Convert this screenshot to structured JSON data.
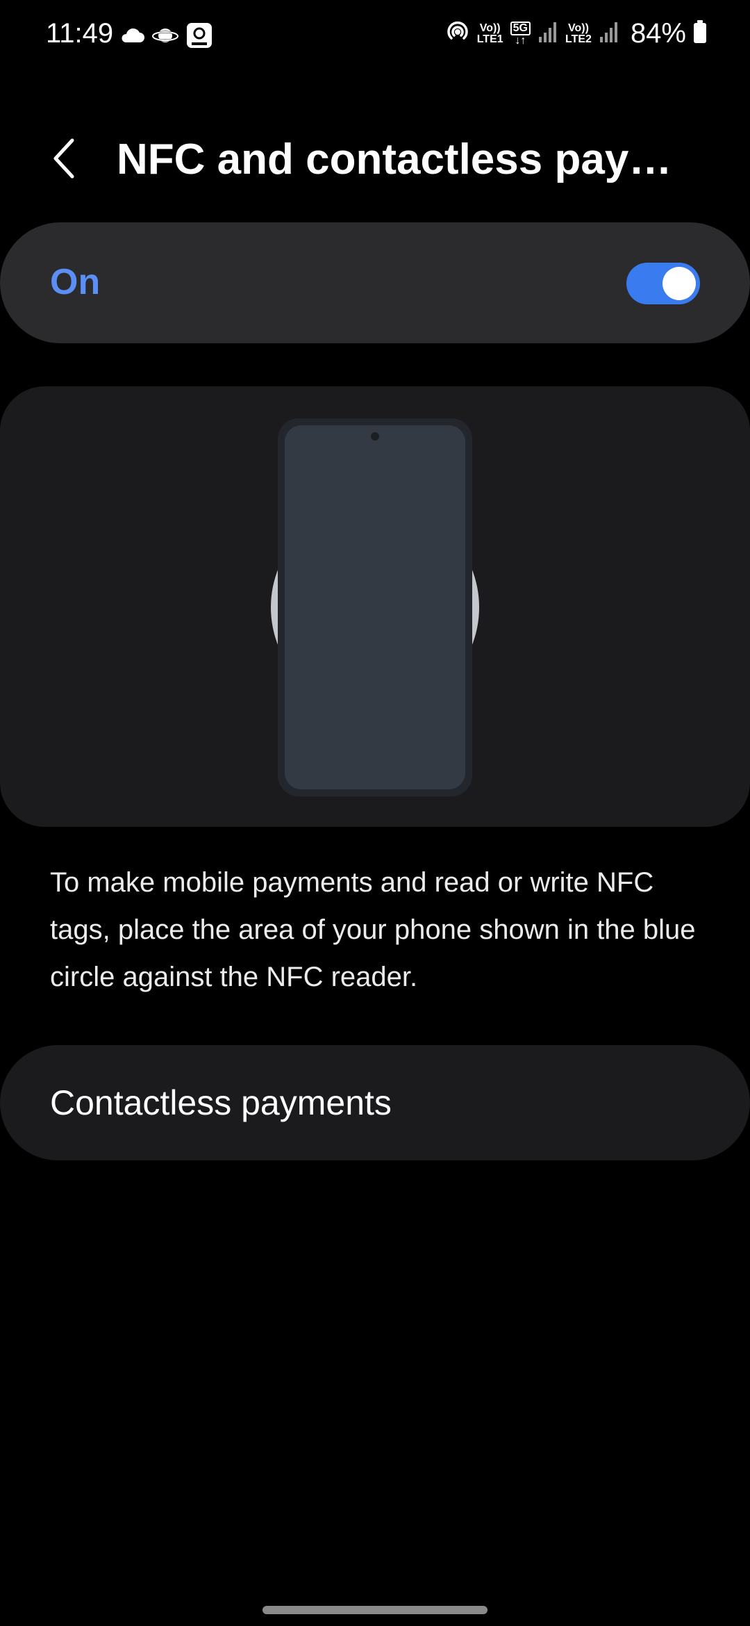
{
  "status_bar": {
    "time": "11:49",
    "left_icons": [
      "cloud-icon",
      "planet-icon",
      "account-badge-icon"
    ],
    "right_icons": [
      "hotspot-icon",
      "volte-lte1-icon",
      "5g-data-icon",
      "signal-icon",
      "volte-lte2-icon",
      "signal-icon",
      "battery-icon"
    ],
    "sim1_label_top": "Vo))",
    "sim1_label_bottom": "LTE1",
    "data_label": "5G",
    "sim2_label_top": "Vo))",
    "sim2_label_bottom": "LTE2",
    "battery_percent": "84%"
  },
  "header": {
    "title": "NFC and contactless paym...",
    "back_icon": "chevron-left-icon"
  },
  "master_switch": {
    "label": "On",
    "state": "on",
    "accent_color": "#3a7cf0"
  },
  "illustration": {
    "description_icon": "phone-nfc-illustration"
  },
  "description": {
    "text": "To make mobile payments and read or write NFC tags, place the area of your phone shown in the blue circle against the NFC reader."
  },
  "menu": {
    "contactless_payments": "Contactless payments"
  }
}
